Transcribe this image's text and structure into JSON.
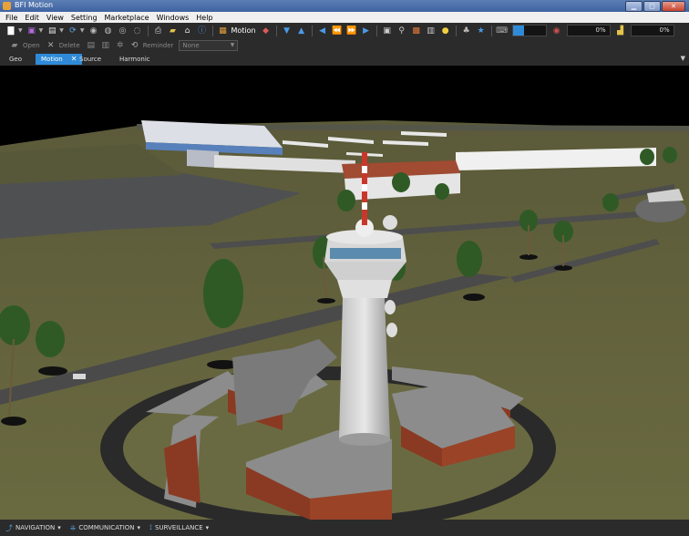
{
  "window": {
    "title": "BFI Motion"
  },
  "menu": [
    "File",
    "Edit",
    "View",
    "Setting",
    "Marketplace",
    "Windows",
    "Help"
  ],
  "toolbar": {
    "motion_label": "Motion",
    "percent_a": "0%",
    "percent_b": "0%",
    "progress_fraction": 0.35
  },
  "toolbar2": {
    "open": "Open",
    "delete": "Delete",
    "reminder": "Reminder",
    "reminder_select": "None"
  },
  "tabs": [
    {
      "label": "Geo"
    },
    {
      "label": "Motion"
    },
    {
      "label": "Source"
    },
    {
      "label": "Harmonic"
    }
  ],
  "bottom": {
    "navigation": "NAVIGATION",
    "communication": "COMMUNICATION",
    "surveillance": "SURVEILLANCE"
  },
  "colors": {
    "accent": "#2f8bd8",
    "panel": "#2b2b2b"
  }
}
